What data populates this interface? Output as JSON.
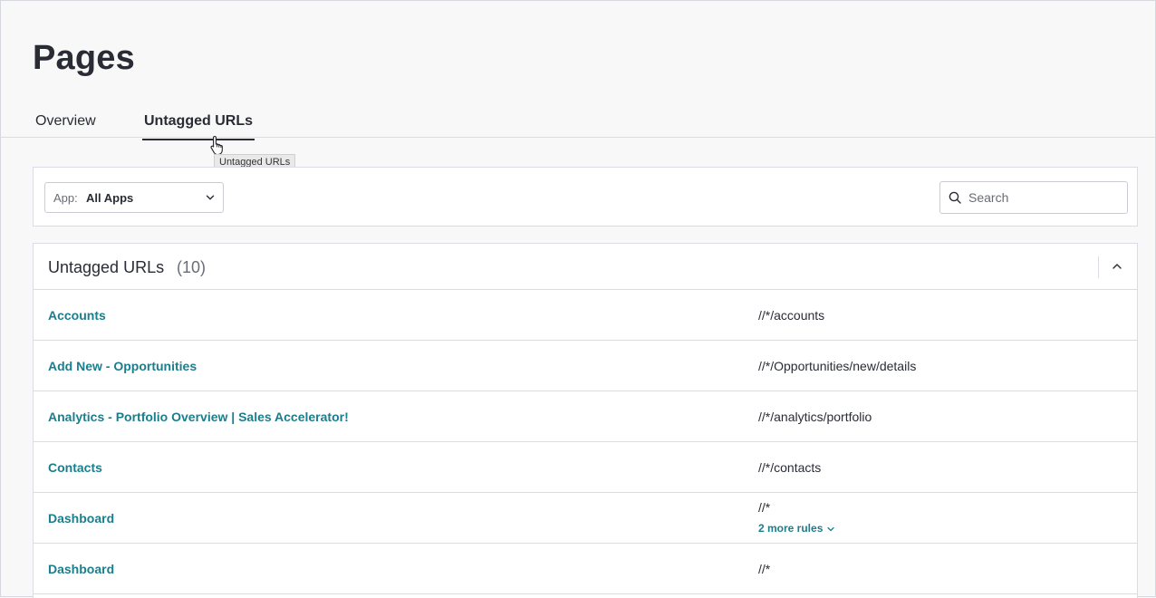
{
  "page": {
    "title": "Pages"
  },
  "tabs": [
    {
      "label": "Overview",
      "active": false
    },
    {
      "label": "Untagged URLs",
      "active": true
    }
  ],
  "tooltip": {
    "text": "Untagged URLs"
  },
  "filters": {
    "app_label": "App:",
    "app_value": "All Apps",
    "search_placeholder": "Search"
  },
  "table": {
    "title": "Untagged URLs",
    "count": "(10)",
    "rows": [
      {
        "name": "Accounts",
        "rule": "//*/accounts"
      },
      {
        "name": "Add New - Opportunities",
        "rule": "//*/Opportunities/new/details"
      },
      {
        "name": "Analytics - Portfolio Overview | Sales Accelerator!",
        "rule": "//*/analytics/portfolio"
      },
      {
        "name": "Contacts",
        "rule": "//*/contacts"
      },
      {
        "name": "Dashboard",
        "rule": "//*",
        "more_rules": "2 more rules"
      },
      {
        "name": "Dashboard",
        "rule": "//*"
      }
    ]
  },
  "colors": {
    "link": "#1a7e8c",
    "text": "#2a2c35",
    "border": "#dadce5",
    "background": "#f8f8f8"
  },
  "icons": {
    "cursor": "hand-pointer-icon",
    "app_dropdown": "chevron-down-icon",
    "search": "search-icon",
    "collapse": "chevron-up-icon",
    "more_rules": "chevron-down-icon"
  }
}
